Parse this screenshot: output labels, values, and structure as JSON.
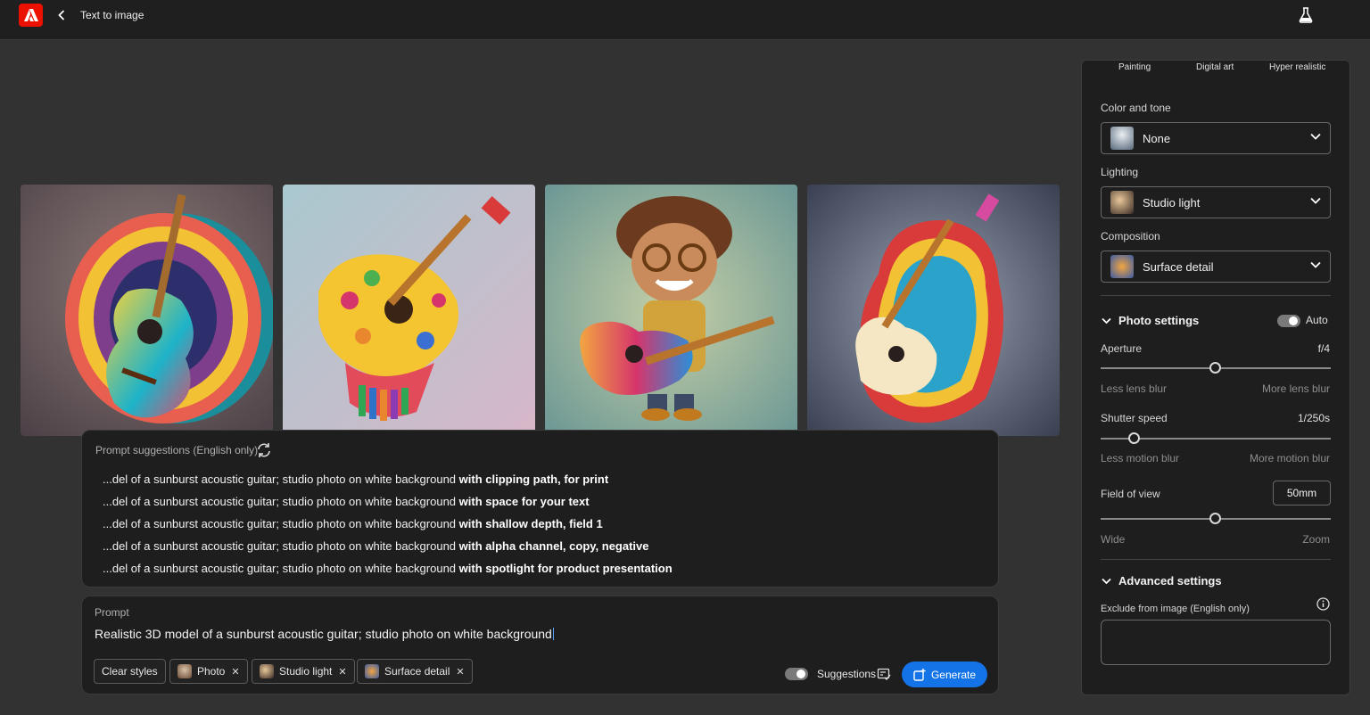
{
  "header": {
    "title": "Text to image"
  },
  "images": [
    {
      "name": "guitar-wheel-image"
    },
    {
      "name": "guitar-dots-image"
    },
    {
      "name": "cartoon-guitarist-image"
    },
    {
      "name": "guitar-layered-image"
    }
  ],
  "suggestions": {
    "header": "Prompt suggestions (English only)",
    "items": [
      {
        "base": "...del of a sunburst acoustic guitar; studio photo on white background ",
        "extra": "with clipping path, for print"
      },
      {
        "base": "...del of a sunburst acoustic guitar; studio photo on white background ",
        "extra": "with space for your text"
      },
      {
        "base": "...del of a sunburst acoustic guitar; studio photo on white background ",
        "extra": "with shallow depth, field 1"
      },
      {
        "base": "...del of a sunburst acoustic guitar; studio photo on white background ",
        "extra": "with alpha channel, copy, negative"
      },
      {
        "base": "...del of a sunburst acoustic guitar; studio photo on white background ",
        "extra": "with spotlight for product presentation"
      }
    ]
  },
  "prompt": {
    "label": "Prompt",
    "text": "Realistic 3D model of a sunburst acoustic guitar; studio photo on white background",
    "clear_styles": "Clear styles",
    "chips": [
      "Photo",
      "Studio light",
      "Surface detail"
    ],
    "suggestions_label": "Suggestions",
    "generate_label": "Generate"
  },
  "right_panel": {
    "style_tabs": [
      "Painting",
      "Digital art",
      "Hyper realistic"
    ],
    "color_tone": {
      "label": "Color and tone",
      "value": "None"
    },
    "lighting": {
      "label": "Lighting",
      "value": "Studio light"
    },
    "composition": {
      "label": "Composition",
      "value": "Surface detail"
    },
    "photo_settings": {
      "title": "Photo settings",
      "auto_label": "Auto",
      "aperture": {
        "label": "Aperture",
        "value": "f/4",
        "min_hint": "Less lens blur",
        "max_hint": "More lens blur",
        "level": 0.5
      },
      "shutter": {
        "label": "Shutter speed",
        "value": "1/250s",
        "min_hint": "Less motion blur",
        "max_hint": "More motion blur",
        "level": 0.15
      },
      "fov": {
        "label": "Field of view",
        "value": "50mm",
        "min_hint": "Wide",
        "max_hint": "Zoom",
        "level": 0.5
      }
    },
    "advanced": {
      "title": "Advanced settings",
      "exclude_label": "Exclude from image (English only)"
    }
  },
  "colors": {
    "accent": "#1473e6",
    "brand": "#eb1000"
  }
}
